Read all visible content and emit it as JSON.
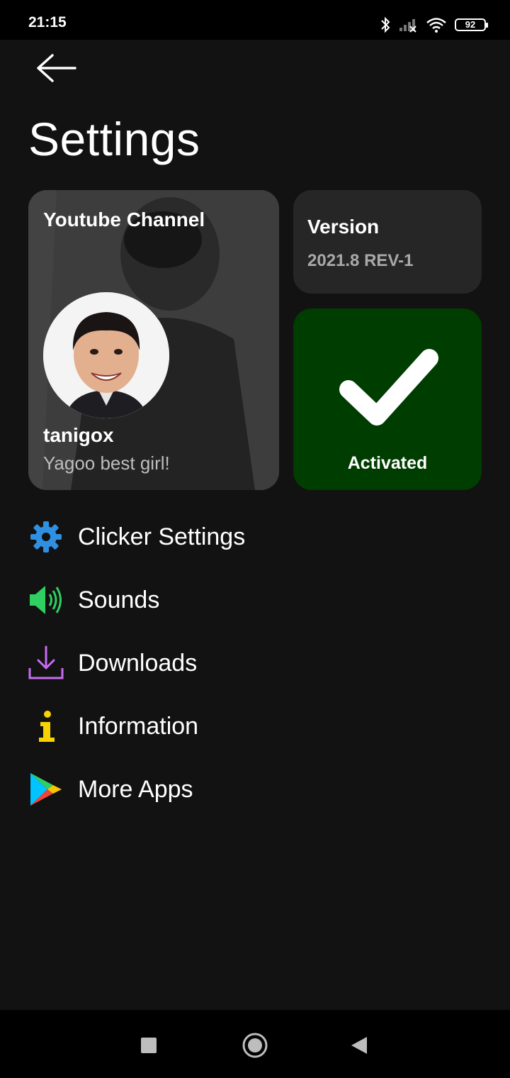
{
  "status": {
    "time": "21:15",
    "battery": "92"
  },
  "header": {
    "title": "Settings"
  },
  "youtube": {
    "title": "Youtube Channel",
    "name": "tanigox",
    "subtitle": "Yagoo best girl!"
  },
  "version": {
    "label": "Version",
    "value": "2021.8 REV-1"
  },
  "activation": {
    "label": "Activated",
    "color": "#003d00"
  },
  "menu": [
    {
      "label": "Clicker Settings",
      "icon": "gear-icon",
      "color": "#2f8fe0"
    },
    {
      "label": "Sounds",
      "icon": "speaker-icon",
      "color": "#2fcf62"
    },
    {
      "label": "Downloads",
      "icon": "download-icon",
      "color": "#c86cf2"
    },
    {
      "label": "Information",
      "icon": "info-icon",
      "color": "#f7d300"
    },
    {
      "label": "More Apps",
      "icon": "play-store-icon",
      "color": "#00c3ff"
    }
  ]
}
